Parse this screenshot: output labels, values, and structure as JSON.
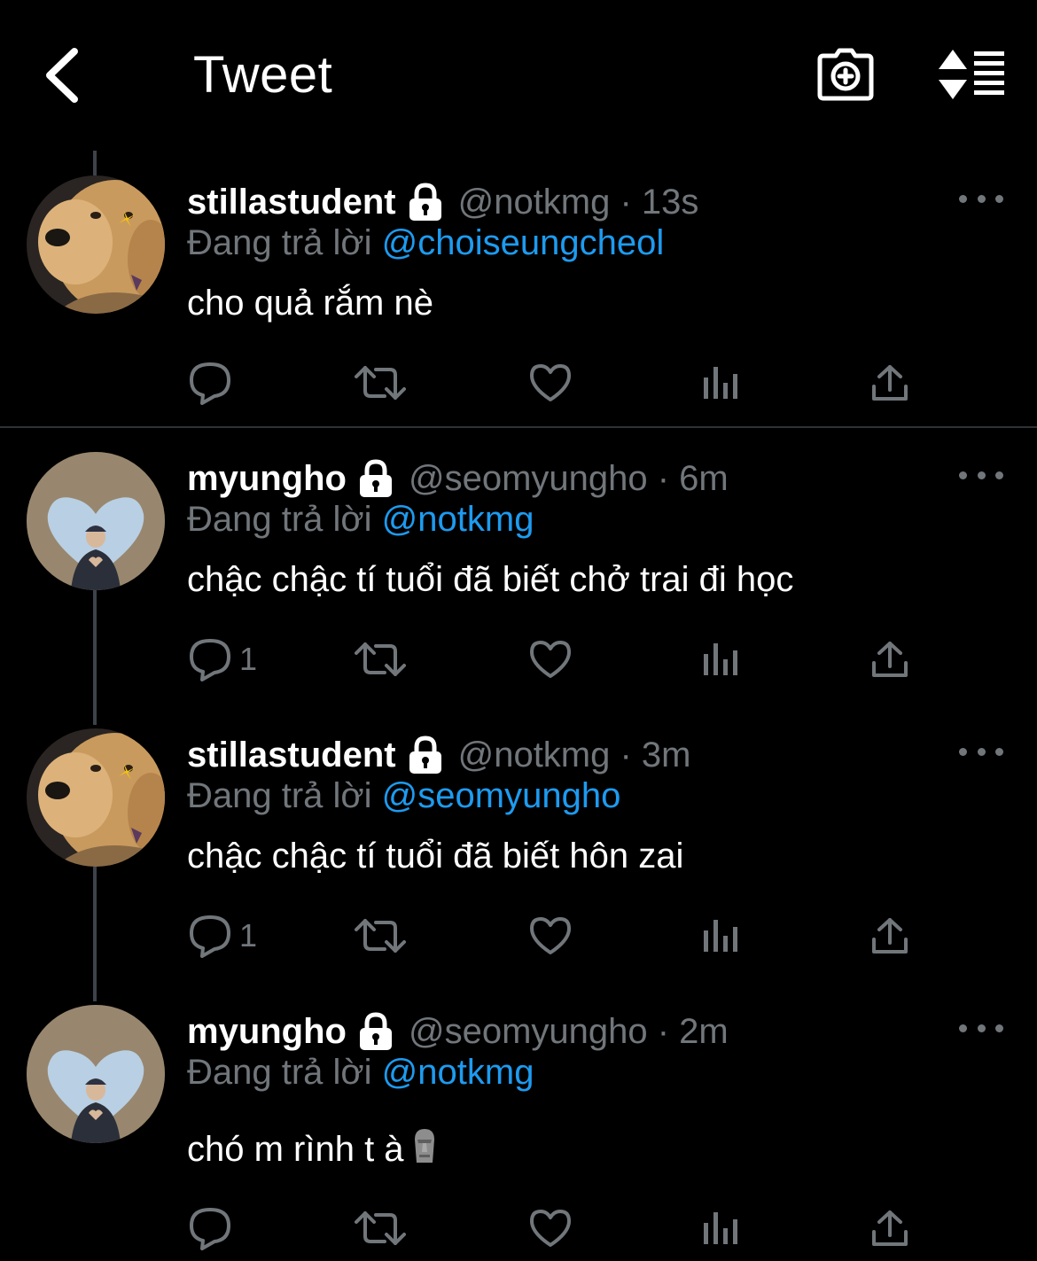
{
  "header": {
    "title": "Tweet",
    "back_icon": "chevron-left-icon",
    "camera_icon": "camera-plus-icon",
    "sort_icon": "sort-lines-icon"
  },
  "colors": {
    "background": "#000000",
    "text": "#ffffff",
    "muted": "#71767b",
    "link": "#1d9bf0",
    "thread_line": "#3d4349"
  },
  "tweets": [
    {
      "display_name": "stillastudent",
      "protected": true,
      "handle_time": "@notkmg · 13s",
      "reply_prefix": "Đang trả lời",
      "reply_to": "@choiseungcheol",
      "text": "cho quả rắm nè",
      "reply_count": "",
      "avatar": "golden-retriever"
    },
    {
      "display_name": "myungho",
      "protected": true,
      "handle_time": "@seomyungho · 6m",
      "reply_prefix": "Đang trả lời",
      "reply_to": "@notkmg",
      "text": "chậc chậc tí tuổi đã biết chở trai đi học",
      "reply_count": "1",
      "avatar": "heart-frame-person"
    },
    {
      "display_name": "stillastudent",
      "protected": true,
      "handle_time": "@notkmg · 3m",
      "reply_prefix": "Đang trả lời",
      "reply_to": "@seomyungho",
      "text": "chậc chậc tí tuổi đã biết hôn zai",
      "reply_count": "1",
      "avatar": "golden-retriever"
    },
    {
      "display_name": "myungho",
      "protected": true,
      "handle_time": "@seomyungho · 2m",
      "reply_prefix": "Đang trả lời",
      "reply_to": "@notkmg",
      "text": "chó m rình t à",
      "emoji": "moai",
      "reply_count": "",
      "avatar": "heart-frame-person"
    }
  ]
}
